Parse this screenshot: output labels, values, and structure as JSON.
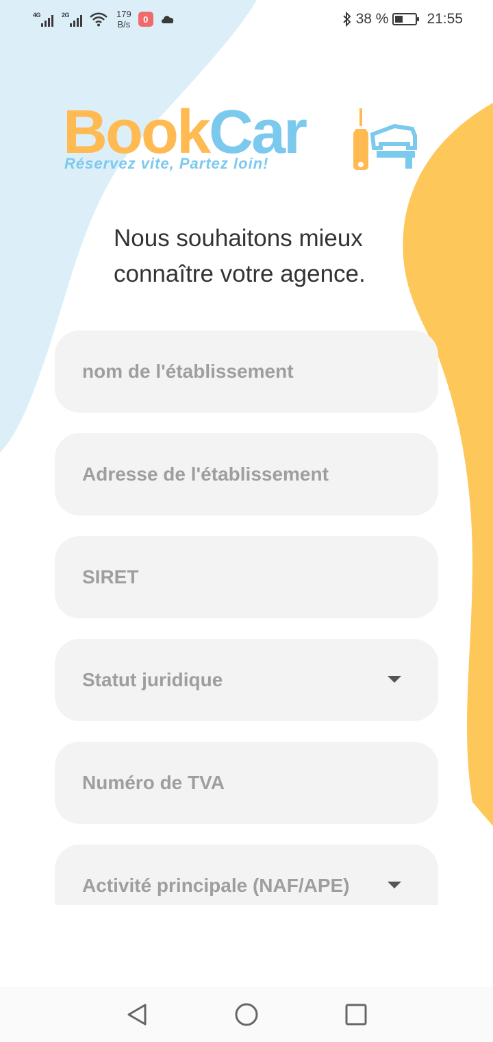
{
  "status_bar": {
    "network1": "4G",
    "network2": "2G",
    "speed_value": "179",
    "speed_unit": "B/s",
    "app_icon_letter": "0",
    "battery_percent": "38 %",
    "time": "21:55"
  },
  "logo": {
    "brand_part1": "Book",
    "brand_part2": "Car",
    "tagline": "Réservez vite, Partez loin!"
  },
  "headline": "Nous souhaitons mieux connaître votre agence.",
  "form": {
    "fields": [
      {
        "placeholder": "nom de l'établissement",
        "type": "text"
      },
      {
        "placeholder": "Adresse de l'établissement",
        "type": "text"
      },
      {
        "placeholder": "SIRET",
        "type": "text"
      },
      {
        "placeholder": "Statut juridique",
        "type": "dropdown"
      },
      {
        "placeholder": "Numéro de TVA",
        "type": "text"
      },
      {
        "placeholder": "Activité principale (NAF/APE)",
        "type": "dropdown"
      }
    ]
  },
  "colors": {
    "brand_orange": "#ffba52",
    "brand_blue": "#7cc9ee",
    "blob_blue": "#dceff8",
    "blob_yellow": "#fdc75a",
    "field_bg": "#f3f3f3"
  },
  "nav_bar": {
    "icons": [
      "back-icon",
      "home-icon",
      "recents-icon"
    ]
  }
}
